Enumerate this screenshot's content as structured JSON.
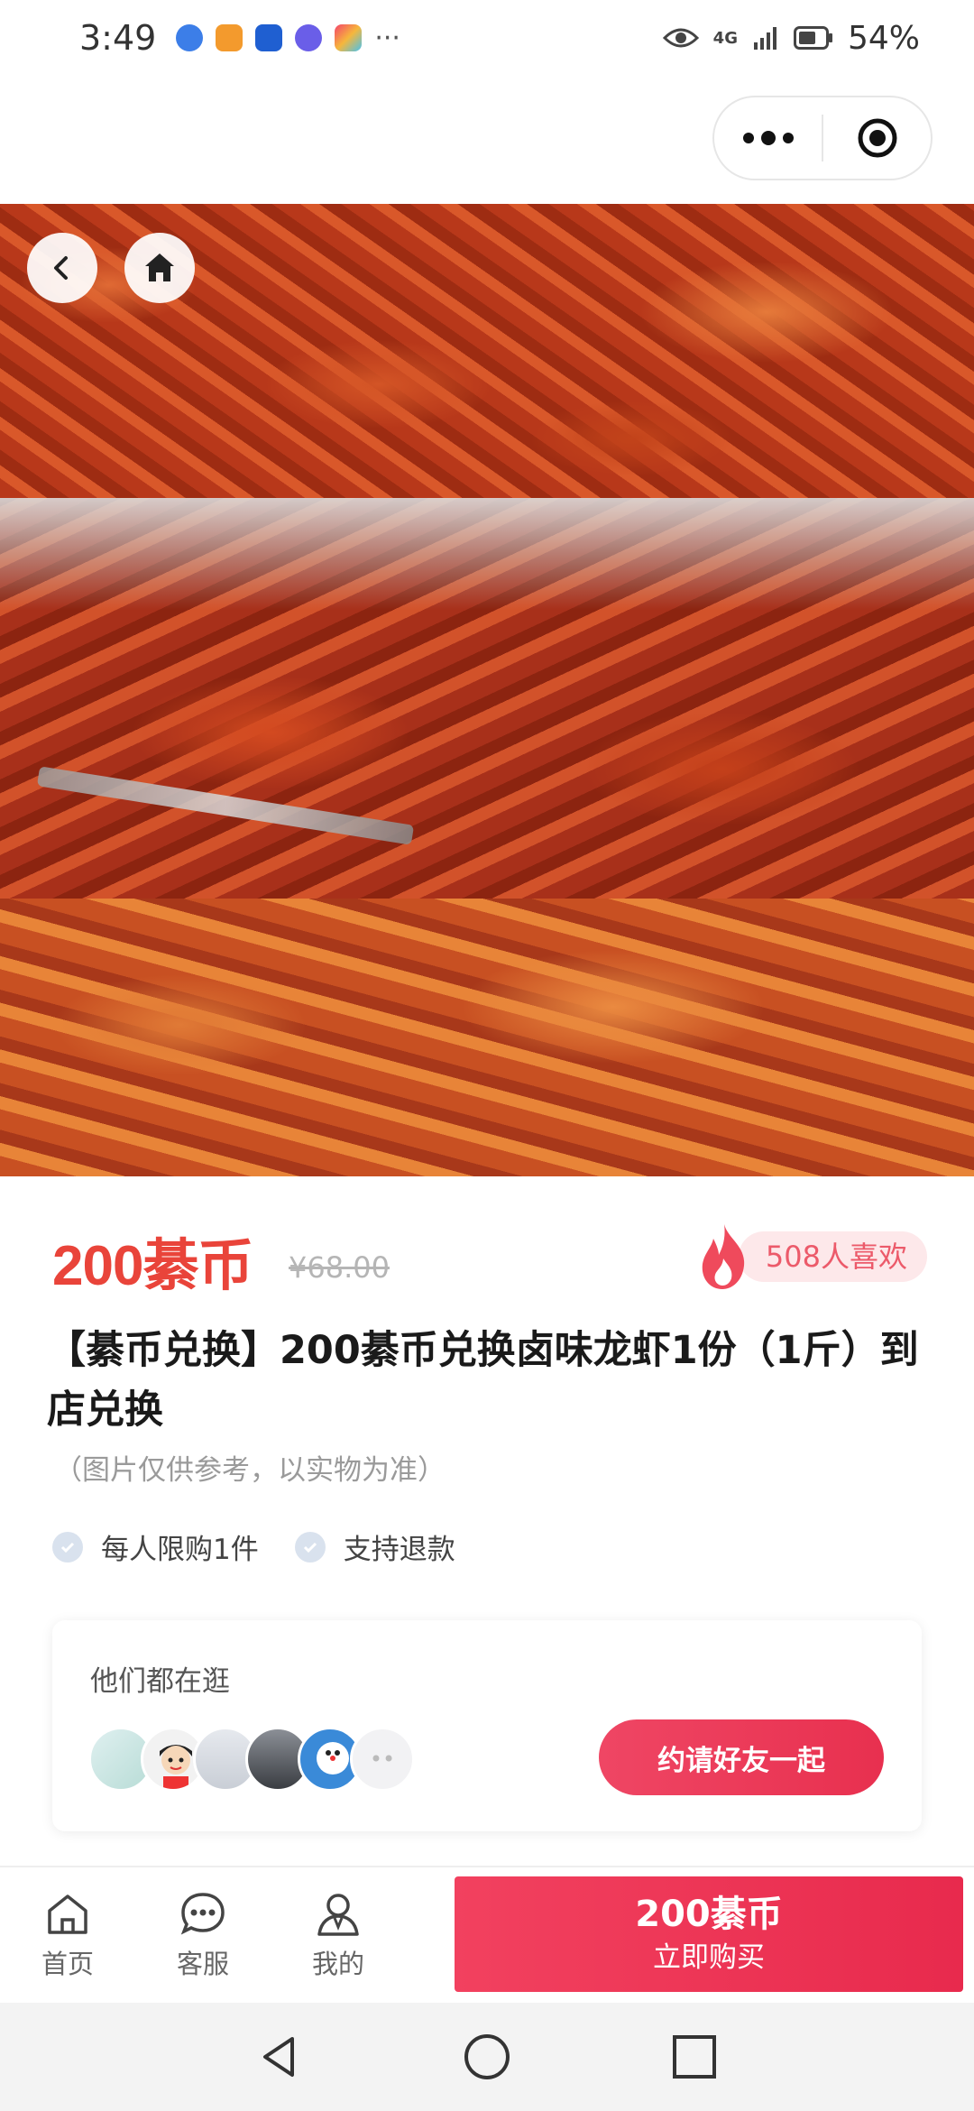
{
  "status_bar": {
    "time": "3:49",
    "network": "4G",
    "battery": "54%",
    "icons": [
      "browser-icon",
      "video-icon",
      "bulb-icon",
      "music-icon",
      "app-icon",
      "more-notifications-icon",
      "eye-icon",
      "signal-icon",
      "battery-icon"
    ]
  },
  "hero": {
    "image_desc_icons": [
      "back-icon",
      "home-icon"
    ]
  },
  "product": {
    "price": "200綦币",
    "original_price": "¥68.00",
    "likes": "508人喜欢",
    "title": "【綦币兑换】200綦币兑换卤味龙虾1份（1斤）到店兑换",
    "note": "（图片仅供参考，以实物为准）",
    "features": [
      "每人限购1件",
      "支持退款"
    ]
  },
  "browsing": {
    "title": "他们都在逛",
    "invite_label": "约请好友一起"
  },
  "bottom_nav": {
    "home": "首页",
    "service": "客服",
    "mine": "我的",
    "buy_price": "200綦币",
    "buy_label": "立即购买"
  },
  "colors": {
    "accent": "#e9443a",
    "button": "#ec3a58",
    "likes_bg": "#fde8ea"
  }
}
